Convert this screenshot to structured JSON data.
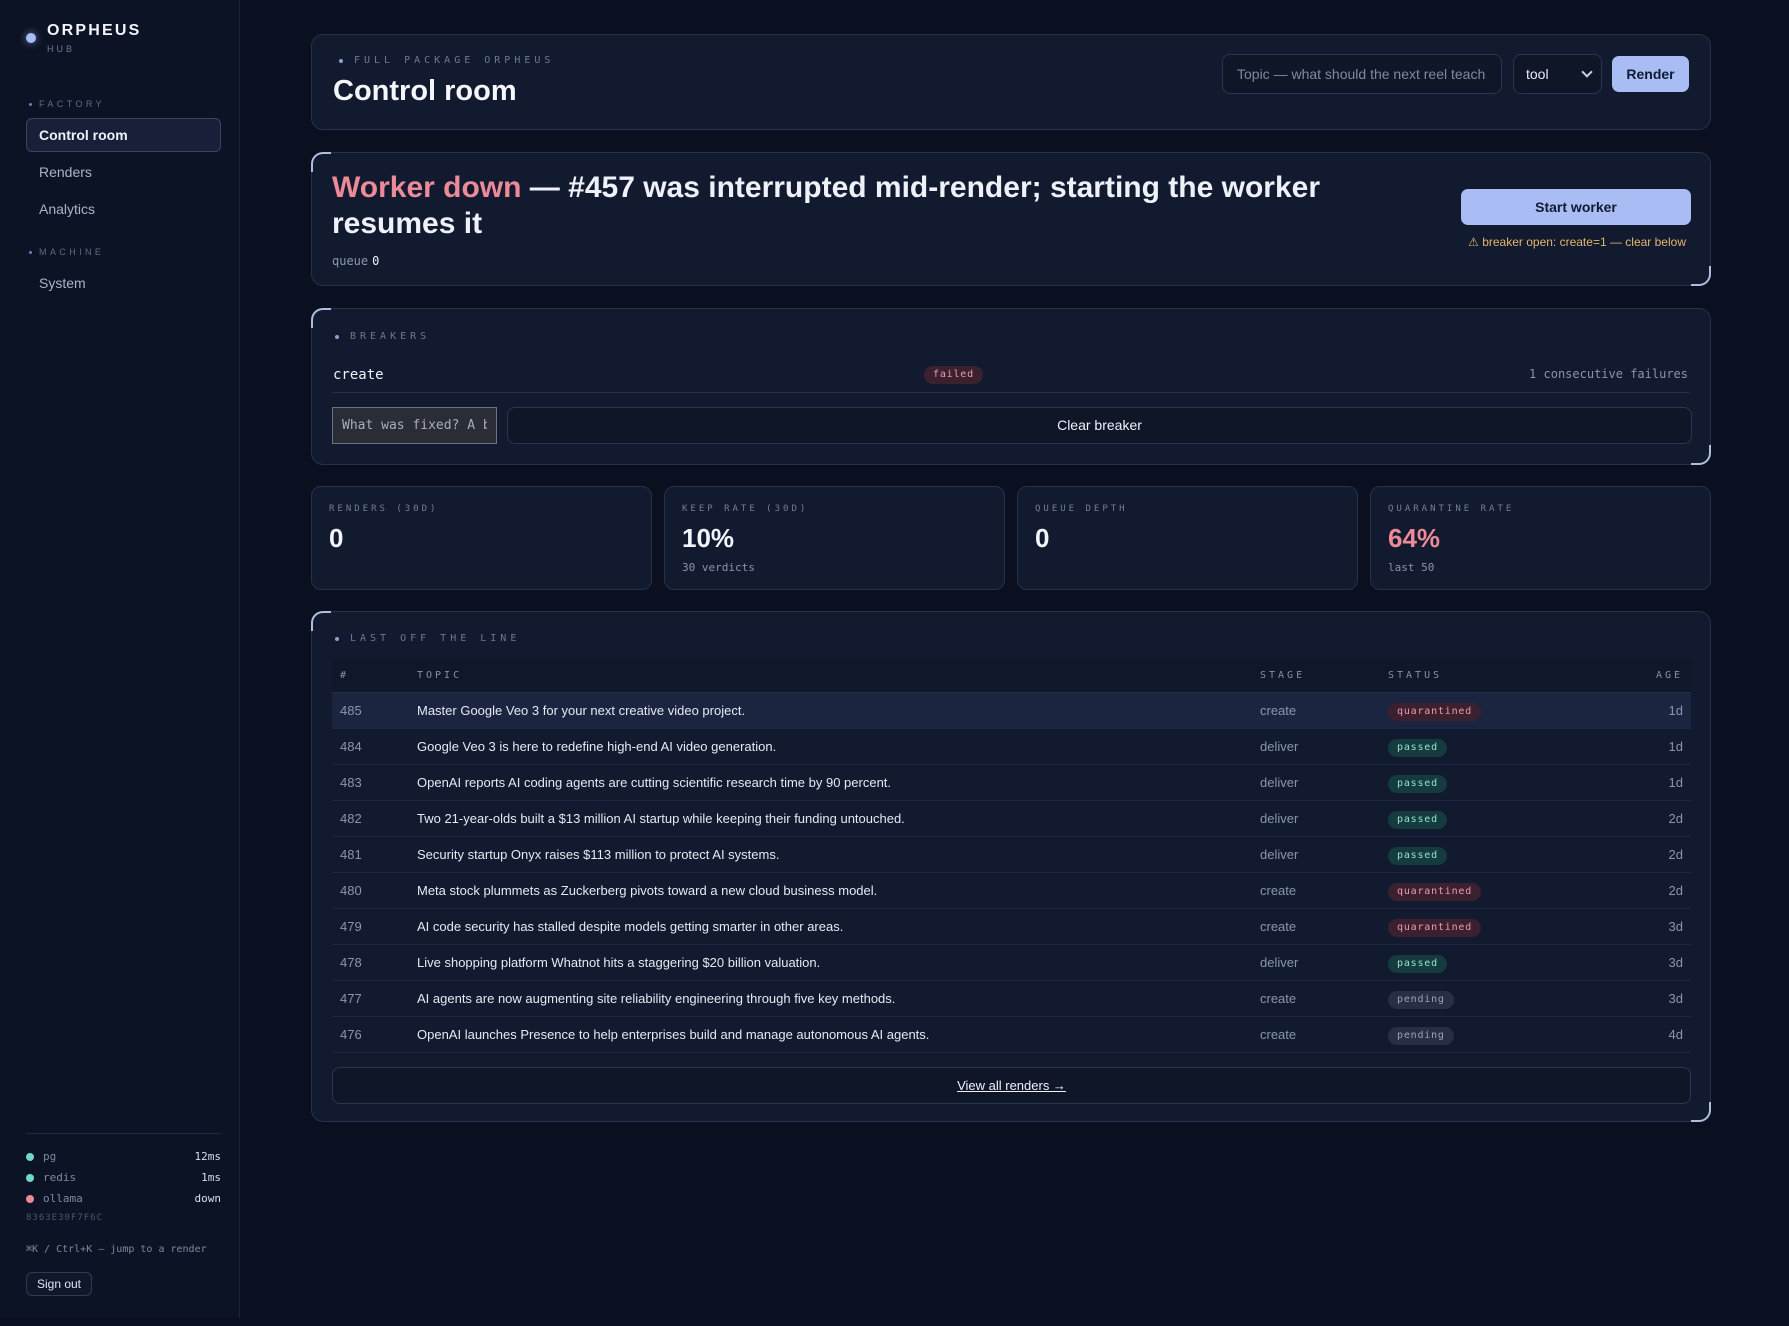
{
  "brand": {
    "name": "ORPHEUS",
    "sub": "HUB"
  },
  "sidebar": {
    "sections": [
      {
        "label": "FACTORY"
      },
      {
        "label": "MACHINE"
      }
    ],
    "items": [
      {
        "label": "Control room"
      },
      {
        "label": "Renders"
      },
      {
        "label": "Analytics"
      },
      {
        "label": "System"
      }
    ],
    "services": [
      {
        "name": "pg",
        "value": "12ms",
        "color": "#6fd8c6"
      },
      {
        "name": "redis",
        "value": "1ms",
        "color": "#6fd8c6"
      },
      {
        "name": "ollama",
        "value": "down",
        "color": "#ec8a99"
      }
    ],
    "build_id": "8363E30F7F6C",
    "shortcut": "⌘K / Ctrl+K — jump to a render",
    "sign_out": "Sign out"
  },
  "header": {
    "eyebrow": "FULL PACKAGE ORPHEUS",
    "title": "Control room",
    "topic_placeholder": "Topic — what should the next reel teach",
    "mode_value": "tool",
    "render_label": "Render"
  },
  "alert": {
    "status": "Worker down",
    "message": " — #457 was interrupted mid-render; starting the worker resumes it",
    "queue_label": "queue",
    "queue_value": "0",
    "start_label": "Start worker",
    "breaker_note": "breaker open: create=1 — clear below"
  },
  "breakers": {
    "eyebrow": "BREAKERS",
    "name": "create",
    "status": "failed",
    "count": "1 consecutive failures",
    "fix_placeholder": "What was fixed? A brief note",
    "clear_label": "Clear breaker"
  },
  "stats": [
    {
      "label": "RENDERS (30D)",
      "value": "0",
      "sub": ""
    },
    {
      "label": "KEEP RATE (30D)",
      "value": "10%",
      "sub": "30 verdicts"
    },
    {
      "label": "QUEUE DEPTH",
      "value": "0",
      "sub": ""
    },
    {
      "label": "QUARANTINE RATE",
      "value": "64%",
      "sub": "last 50"
    }
  ],
  "recent": {
    "eyebrow": "LAST OFF THE LINE",
    "columns": {
      "id": "#",
      "topic": "TOPIC",
      "stage": "STAGE",
      "status": "STATUS",
      "age": "AGE"
    },
    "rows": [
      {
        "id": "485",
        "topic": "Master Google Veo 3 for your next creative video project.",
        "stage": "create",
        "status": "quarantined",
        "age": "1d"
      },
      {
        "id": "484",
        "topic": "Google Veo 3 is here to redefine high-end AI video generation.",
        "stage": "deliver",
        "status": "passed",
        "age": "1d"
      },
      {
        "id": "483",
        "topic": "OpenAI reports AI coding agents are cutting scientific research time by 90 percent.",
        "stage": "deliver",
        "status": "passed",
        "age": "1d"
      },
      {
        "id": "482",
        "topic": "Two 21-year-olds built a $13 million AI startup while keeping their funding untouched.",
        "stage": "deliver",
        "status": "passed",
        "age": "2d"
      },
      {
        "id": "481",
        "topic": "Security startup Onyx raises $113 million to protect AI systems.",
        "stage": "deliver",
        "status": "passed",
        "age": "2d"
      },
      {
        "id": "480",
        "topic": "Meta stock plummets as Zuckerberg pivots toward a new cloud business model.",
        "stage": "create",
        "status": "quarantined",
        "age": "2d"
      },
      {
        "id": "479",
        "topic": "AI code security has stalled despite models getting smarter in other areas.",
        "stage": "create",
        "status": "quarantined",
        "age": "3d"
      },
      {
        "id": "478",
        "topic": "Live shopping platform Whatnot hits a staggering $20 billion valuation.",
        "stage": "deliver",
        "status": "passed",
        "age": "3d"
      },
      {
        "id": "477",
        "topic": "AI agents are now augmenting site reliability engineering through five key methods.",
        "stage": "create",
        "status": "pending",
        "age": "3d"
      },
      {
        "id": "476",
        "topic": "OpenAI launches Presence to help enterprises build and manage autonomous AI agents.",
        "stage": "create",
        "status": "pending",
        "age": "4d"
      }
    ],
    "view_all": "View all renders →"
  }
}
